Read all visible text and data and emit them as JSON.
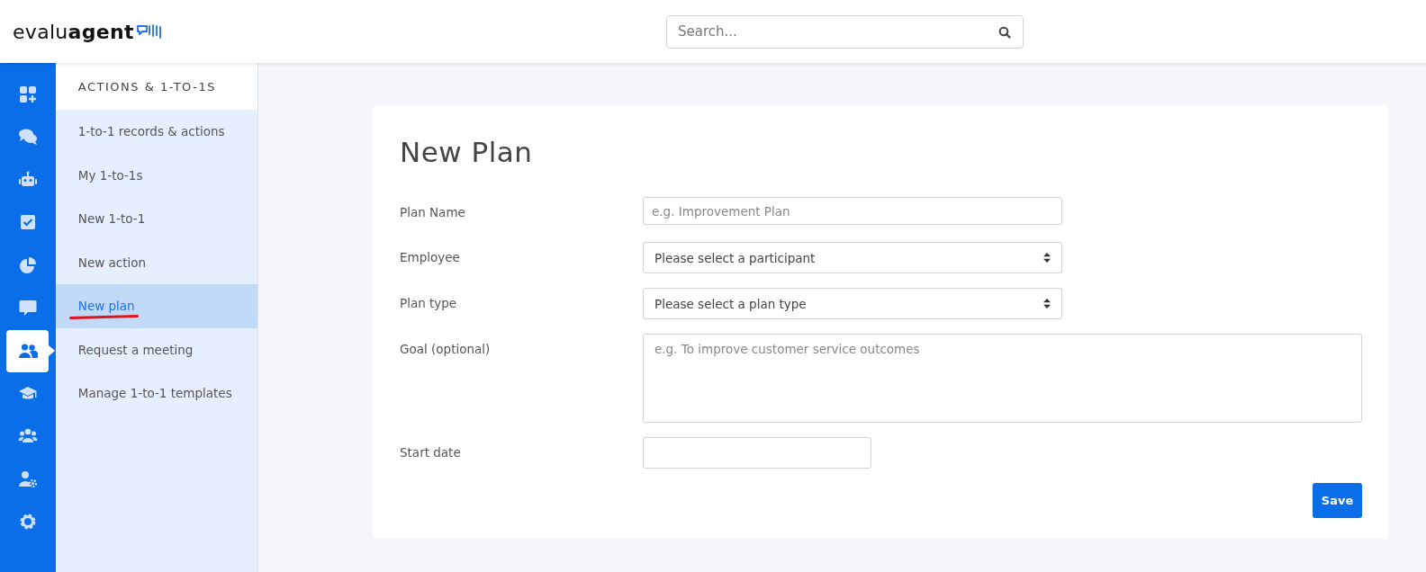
{
  "header": {
    "logo": "evalu**agent**",
    "search": {
      "placeholder": "Search..."
    }
  },
  "rail": [
    {
      "kind": "dashboard",
      "selected": false
    },
    {
      "kind": "chats",
      "selected": false
    },
    {
      "kind": "robot",
      "selected": false
    },
    {
      "kind": "tasks",
      "selected": false
    },
    {
      "kind": "reports",
      "selected": false
    },
    {
      "kind": "comment",
      "selected": false
    },
    {
      "kind": "users",
      "selected": true
    },
    {
      "kind": "training",
      "selected": false
    },
    {
      "kind": "teams",
      "selected": false
    },
    {
      "kind": "user-settings",
      "selected": false
    },
    {
      "kind": "settings",
      "selected": false
    }
  ],
  "sidebar": {
    "title": "ACTIONS & 1-TO-1S",
    "items": [
      {
        "label": "1-to-1 records & actions",
        "selected": false
      },
      {
        "label": "My 1-to-1s",
        "selected": false
      },
      {
        "label": "New 1-to-1",
        "selected": false
      },
      {
        "label": "New action",
        "selected": false
      },
      {
        "label": "New plan",
        "selected": true
      },
      {
        "label": "Request a meeting",
        "selected": false
      },
      {
        "label": "Manage 1-to-1 templates",
        "selected": false
      }
    ]
  },
  "form": {
    "title": "New Plan",
    "fields": [
      {
        "label": "Plan Name",
        "kind": "text",
        "placeholder": "e.g. Improvement Plan"
      },
      {
        "label": "Employee",
        "kind": "select",
        "value": "Please select a participant"
      },
      {
        "label": "Plan type",
        "kind": "select",
        "value": "Please select a plan type"
      },
      {
        "label": "Goal (optional)",
        "kind": "textarea",
        "placeholder": "e.g. To improve customer service outcomes"
      },
      {
        "label": "Start date",
        "kind": "date"
      }
    ],
    "save_button": "Save"
  }
}
